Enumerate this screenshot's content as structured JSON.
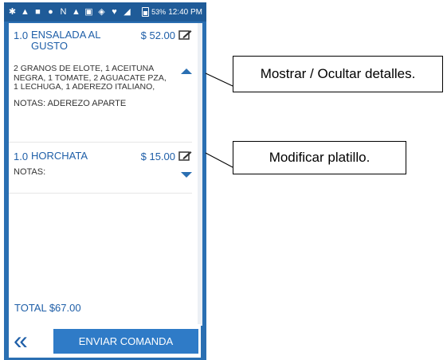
{
  "status_bar": {
    "icons": [
      "settings-icon",
      "warning-icon",
      "calendar-icon",
      "s-app-icon",
      "n-app-icon",
      "warning-icon",
      "image-icon",
      "sync-icon",
      "location-icon",
      "signal-icon",
      "battery-icon"
    ],
    "battery": "53%",
    "time": "12:40 PM"
  },
  "order": {
    "items": [
      {
        "qty": "1.0",
        "name": "ENSALADA AL GUSTO",
        "price": "$ 52.00",
        "details": "2 GRANOS DE ELOTE, 1 ACEITUNA NEGRA, 1 TOMATE, 2 AGUACATE PZA, 1 LECHUGA, 1 ADEREZO ITALIANO,",
        "notes_label": "NOTAS:",
        "notes_value": "ADEREZO APARTE",
        "expanded": true
      },
      {
        "qty": "1.0",
        "name": "HORCHATA",
        "price": "$ 15.00",
        "details": "",
        "notes_label": "NOTAS:",
        "notes_value": "",
        "expanded": false
      }
    ],
    "total": "TOTAL $67.00"
  },
  "bottom": {
    "back_symbol": "«",
    "send_label": "ENVIAR COMANDA"
  },
  "callouts": {
    "toggle_details": "Mostrar / Ocultar detalles.",
    "modify_dish": "Modificar platillo."
  },
  "colors": {
    "primary": "#2a6fb2",
    "text_blue": "#1f5fa8",
    "button": "#2f7bc7"
  }
}
